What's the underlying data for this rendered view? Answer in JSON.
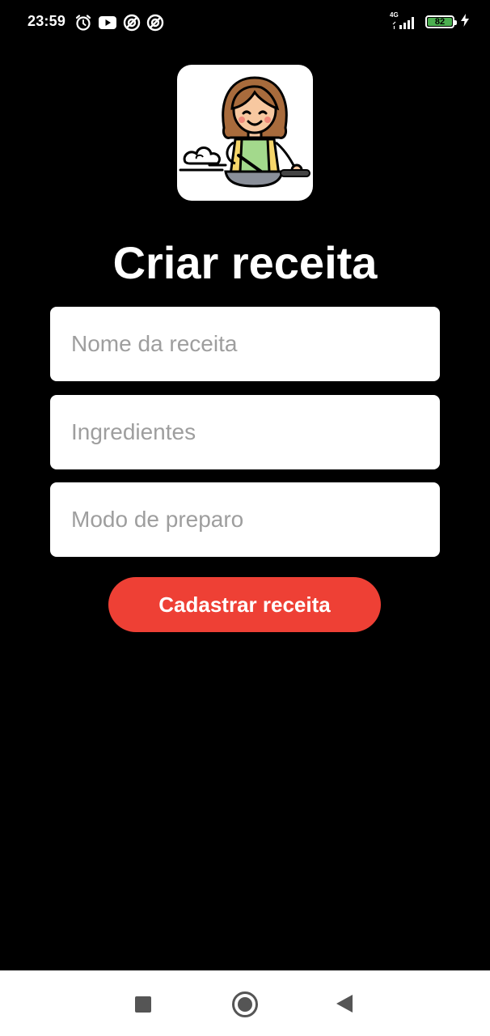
{
  "status_bar": {
    "time": "23:59",
    "network_type": "4G",
    "battery_level": "82",
    "icons": [
      "alarm-icon",
      "youtube-icon",
      "app-icon",
      "app-icon",
      "signal-icon",
      "battery-icon",
      "charging-icon"
    ]
  },
  "logo": {
    "icon": "chef-cooking-icon"
  },
  "page": {
    "title": "Criar receita"
  },
  "form": {
    "name_placeholder": "Nome da receita",
    "ingredients_placeholder": "Ingredientes",
    "method_placeholder": "Modo de preparo",
    "submit_label": "Cadastrar receita"
  },
  "colors": {
    "background": "#000000",
    "button": "#ee4035",
    "input_background": "#ffffff",
    "placeholder": "#9e9e9e",
    "battery": "#4caf50"
  },
  "navigation": {
    "icons": [
      "recents-icon",
      "home-icon",
      "back-icon"
    ]
  }
}
